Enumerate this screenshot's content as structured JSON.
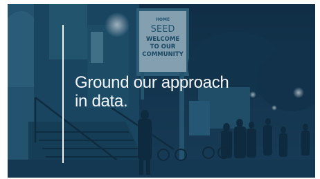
{
  "slide": {
    "headline": {
      "line1": "Ground our approach",
      "line2": "in data."
    },
    "accent_color": "#f2f5f8",
    "overlay_color": "#16405f"
  },
  "photo": {
    "sign": {
      "top_text": "HOME",
      "org_name": "SEED",
      "line1": "WELCOME",
      "line2": "TO OUR",
      "line3": "COMMUNITY"
    }
  }
}
